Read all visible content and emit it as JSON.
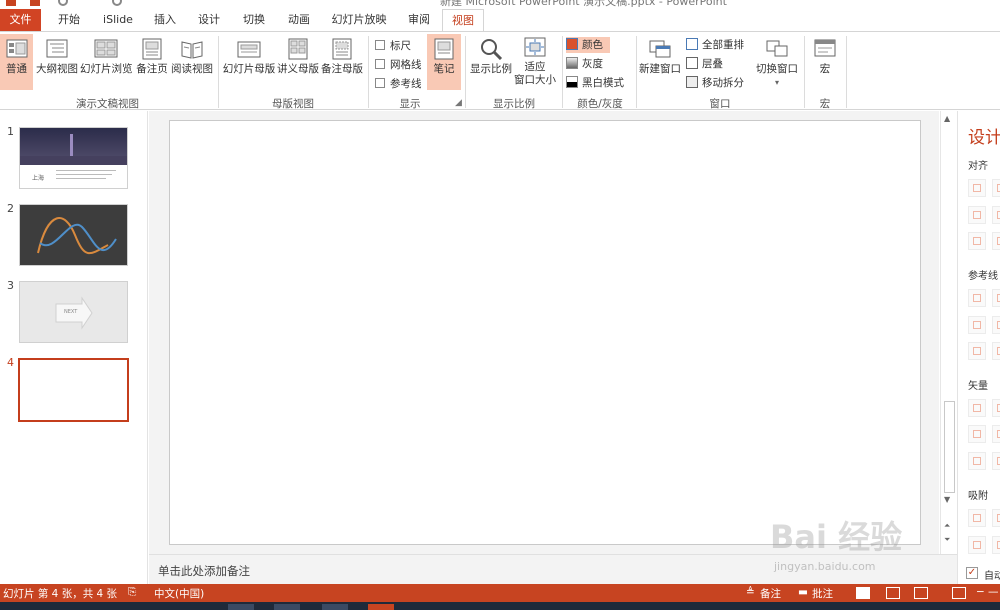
{
  "window": {
    "title": "新建 Microsoft PowerPoint 演示文稿.pptx - PowerPoint"
  },
  "tabs": [
    "文件",
    "开始",
    "iSlide",
    "插入",
    "设计",
    "切换",
    "动画",
    "幻灯片放映",
    "审阅",
    "视图"
  ],
  "active_tab": "视图",
  "ribbon": {
    "presentation_views": {
      "label": "演示文稿视图",
      "buttons": [
        "普通",
        "大纲视图",
        "幻灯片浏览",
        "备注页",
        "阅读视图"
      ],
      "selected": "普通"
    },
    "master_views": {
      "label": "母版视图",
      "buttons": [
        "幻灯片母版",
        "讲义母版",
        "备注母版"
      ]
    },
    "show": {
      "label": "显示",
      "checkboxes": [
        {
          "label": "标尺",
          "checked": false
        },
        {
          "label": "网格线",
          "checked": false
        },
        {
          "label": "参考线",
          "checked": false
        }
      ],
      "notes_button": "笔记"
    },
    "zoom": {
      "label": "显示比例",
      "buttons": [
        "显示比例",
        "适应",
        "窗口大小"
      ]
    },
    "color": {
      "label": "颜色/灰度",
      "items": [
        {
          "label": "颜色",
          "swatch": "#d9512c",
          "selected": true
        },
        {
          "label": "灰度",
          "swatch": "#7a7a7a",
          "selected": false
        },
        {
          "label": "黑白模式",
          "swatch": "#000000",
          "selected": false
        }
      ]
    },
    "window": {
      "label": "窗口",
      "new_window": "新建窗口",
      "items": [
        "全部重排",
        "层叠",
        "移动拆分"
      ],
      "switch": "切换窗口"
    },
    "macro": {
      "label": "宏",
      "button": "宏"
    }
  },
  "thumbnails": [
    {
      "number": "1",
      "caption": "上海",
      "active": false
    },
    {
      "number": "2",
      "active": false
    },
    {
      "number": "3",
      "caption": "NEXT",
      "active": false
    },
    {
      "number": "4",
      "active": true
    }
  ],
  "notes": {
    "placeholder": "单击此处添加备注"
  },
  "design_pane": {
    "title": "设计",
    "sections": [
      "对齐",
      "参考线",
      "矢量",
      "吸附"
    ],
    "check_label": "自动"
  },
  "status": {
    "slide_info": "幻灯片 第 4 张，共 4 张",
    "language": "中文(中国)",
    "notes_btn": "备注",
    "comments_btn": "批注"
  },
  "watermark": {
    "text": "Bai 经验",
    "url": "jingyan.baidu.com"
  },
  "colors": {
    "accent": "#c43e1c",
    "status_bar": "#c74421",
    "selected": "#f9c9b5"
  }
}
